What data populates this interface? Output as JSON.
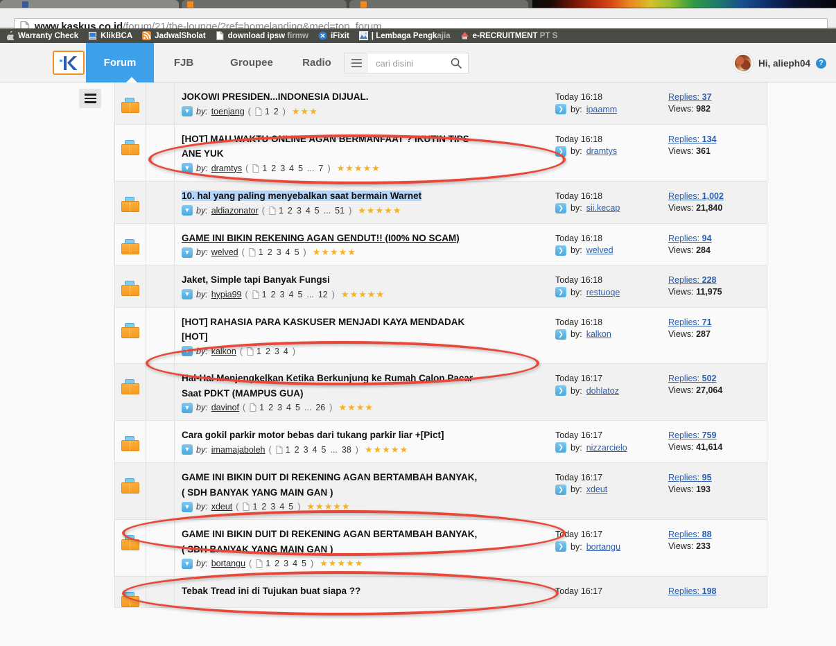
{
  "browser": {
    "url_prefix": "www.kaskus.co.id",
    "url_suffix": "/forum/21/the-lounge/?ref=homelanding&med=top_forum",
    "bookmarks": [
      {
        "label": "Warranty Check",
        "dim": "",
        "icon": "apple-icon"
      },
      {
        "label": "KlikBCA",
        "dim": "",
        "icon": "klikbca-icon"
      },
      {
        "label": "JadwalSholat",
        "dim": "",
        "icon": "rss-icon"
      },
      {
        "label": "download ipsw",
        "dim": " firmw",
        "icon": "page-icon"
      },
      {
        "label": "iFixit",
        "dim": "",
        "icon": "ifixit-icon"
      },
      {
        "label": "| Lembaga Pengk",
        "dim": "ajia",
        "icon": "lembaga-icon"
      },
      {
        "label": "e-RECRUITMENT",
        "dim": " PT S",
        "icon": "recruitment-icon"
      }
    ]
  },
  "site_header": {
    "logo_alt": "kaskus-logo",
    "nav": [
      {
        "label": "Forum",
        "active": true
      },
      {
        "label": "FJB",
        "active": false
      },
      {
        "label": "Groupee",
        "active": false
      },
      {
        "label": "Radio",
        "active": false
      }
    ],
    "search": {
      "placeholder": "cari disini",
      "value": ""
    },
    "user": {
      "greeting": "Hi, alieph04",
      "help_label": "?"
    },
    "accent_blue": "#3da0e8",
    "accent_orange": "#f0911e"
  },
  "thread_list": {
    "by_label": "by:",
    "replies_label": "Replies:",
    "views_label": "Views:",
    "rows": [
      {
        "title": "JOKOWI PRESIDEN...INDONESIA DIJUAL.",
        "title2": "",
        "author": "toenjang",
        "pages": [
          "1",
          "2"
        ],
        "ellipsis": false,
        "last_page": "",
        "stars": 3,
        "time": "Today 16:18",
        "last_poster": "ipaamm",
        "replies": "37",
        "views": "982",
        "state": "normal",
        "circled": false
      },
      {
        "title": "[HOT] MAU WAKTU ONLINE AGAN BERMANFAAT ? IKUTIN TIPS",
        "title2": "ANE YUK",
        "author": "dramtys",
        "pages": [
          "1",
          "2",
          "3",
          "4",
          "5"
        ],
        "ellipsis": true,
        "last_page": "7",
        "stars": 5,
        "time": "Today 16:18",
        "last_poster": "dramtys",
        "replies": "134",
        "views": "361",
        "state": "normal",
        "circled": true
      },
      {
        "title": "10. hal yang paling menyebalkan saat bermain Warnet",
        "title2": "",
        "author": "aldiazonator",
        "pages": [
          "1",
          "2",
          "3",
          "4",
          "5"
        ],
        "ellipsis": true,
        "last_page": "51",
        "stars": 5,
        "time": "Today 16:18",
        "last_poster": "sii.kecap",
        "replies": "1,002",
        "views": "21,840",
        "state": "highlighted",
        "circled": false
      },
      {
        "title": "GAME INI BIKIN REKENING AGAN GENDUT!! (I00% NO SCAM)",
        "title2": "",
        "author": "welved",
        "pages": [
          "1",
          "2",
          "3",
          "4",
          "5"
        ],
        "ellipsis": false,
        "last_page": "",
        "stars": 5,
        "time": "Today 16:18",
        "last_poster": "welved",
        "replies": "94",
        "views": "284",
        "state": "hovered",
        "circled": false
      },
      {
        "title": "Jaket, Simple tapi Banyak Fungsi",
        "title2": "",
        "author": "hypia99",
        "pages": [
          "1",
          "2",
          "3",
          "4",
          "5"
        ],
        "ellipsis": true,
        "last_page": "12",
        "stars": 5,
        "time": "Today 16:18",
        "last_poster": "restuoqe",
        "replies": "228",
        "views": "11,975",
        "state": "normal",
        "circled": false
      },
      {
        "title": "[HOT] RAHASIA PARA KASKUSER MENJADI KAYA MENDADAK",
        "title2": "[HOT]",
        "author": "kalkon",
        "pages": [
          "1",
          "2",
          "3",
          "4"
        ],
        "ellipsis": false,
        "last_page": "",
        "stars": 0,
        "time": "Today 16:18",
        "last_poster": "kalkon",
        "replies": "71",
        "views": "287",
        "state": "normal",
        "circled": true
      },
      {
        "title": "Hal-Hal Menjengkelkan Ketika Berkunjung ke Rumah Calon Pacar",
        "title2": "Saat PDKT (MAMPUS GUA)",
        "author": "davinof",
        "pages": [
          "1",
          "2",
          "3",
          "4",
          "5"
        ],
        "ellipsis": true,
        "last_page": "26",
        "stars": 4,
        "time": "Today 16:17",
        "last_poster": "dohlatoz",
        "replies": "502",
        "views": "27,064",
        "state": "normal",
        "circled": false
      },
      {
        "title": "Cara gokil parkir motor bebas dari tukang parkir liar +[Pict]",
        "title2": "",
        "author": "imamajaboleh",
        "pages": [
          "1",
          "2",
          "3",
          "4",
          "5"
        ],
        "ellipsis": true,
        "last_page": "38",
        "stars": 5,
        "time": "Today 16:17",
        "last_poster": "nizzarcielo",
        "replies": "759",
        "views": "41,614",
        "state": "normal",
        "circled": false
      },
      {
        "title": "GAME INI BIKIN DUIT DI REKENING AGAN BERTAMBAH BANYAK,",
        "title2": "( SDH BANYAK YANG MAIN GAN )",
        "author": "xdeut",
        "pages": [
          "1",
          "2",
          "3",
          "4",
          "5"
        ],
        "ellipsis": false,
        "last_page": "",
        "stars": 5,
        "time": "Today 16:17",
        "last_poster": "xdeut",
        "replies": "95",
        "views": "193",
        "state": "normal",
        "circled": true
      },
      {
        "title": "GAME INI BIKIN DUIT DI REKENING AGAN BERTAMBAH BANYAK,",
        "title2": "( SDH BANYAK YANG MAIN GAN )",
        "author": "bortangu",
        "pages": [
          "1",
          "2",
          "3",
          "4",
          "5"
        ],
        "ellipsis": false,
        "last_page": "",
        "stars": 5,
        "time": "Today 16:17",
        "last_poster": "bortangu",
        "replies": "88",
        "views": "233",
        "state": "normal",
        "circled": true
      },
      {
        "title": "Tebak Tread ini di Tujukan buat siapa ??",
        "title2": "",
        "author": "",
        "pages": [],
        "ellipsis": false,
        "last_page": "",
        "stars": 0,
        "time": "Today 16:17",
        "last_poster": "",
        "replies": "198",
        "views": "",
        "state": "normal",
        "circled": false
      }
    ]
  },
  "annotation": {
    "color": "#e8483a",
    "shape": "ellipse",
    "count": 4
  }
}
